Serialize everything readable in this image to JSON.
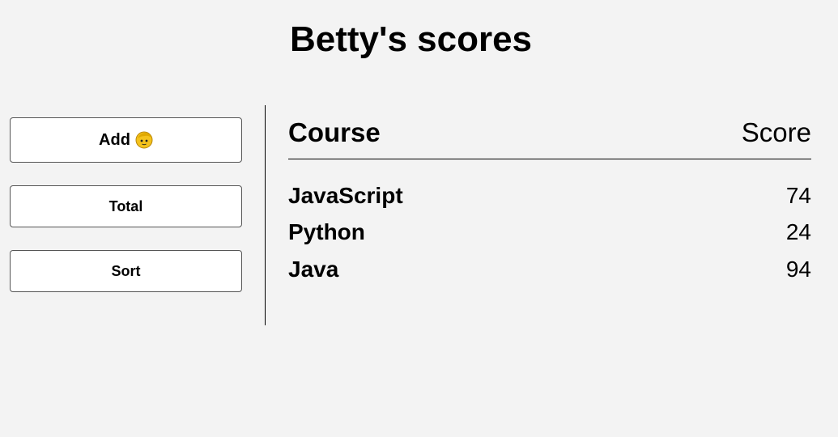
{
  "page": {
    "title": "Betty's scores"
  },
  "sidebar": {
    "add_label": "Add",
    "add_icon": "smiling-face-icon",
    "total_label": "Total",
    "sort_label": "Sort"
  },
  "table": {
    "headers": {
      "course": "Course",
      "score": "Score"
    },
    "rows": [
      {
        "course": "JavaScript",
        "score": "74"
      },
      {
        "course": "Python",
        "score": "24"
      },
      {
        "course": "Java",
        "score": "94"
      }
    ]
  },
  "colors": {
    "background": "#f3f3f3",
    "button_background": "#ffffff",
    "emoji_yellow": "#f4c21c"
  }
}
